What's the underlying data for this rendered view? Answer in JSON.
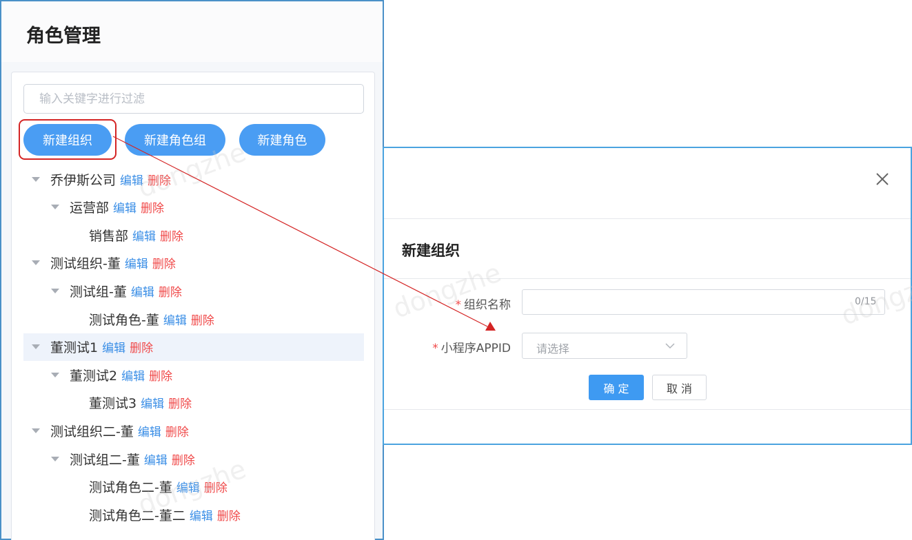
{
  "page": {
    "title": "角色管理"
  },
  "filter": {
    "placeholder": "输入关键字进行过滤"
  },
  "toolbar": {
    "new_org": "新建组织",
    "new_role_group": "新建角色组",
    "new_role": "新建角色"
  },
  "tree": {
    "edit_label": "编辑",
    "delete_label": "删除",
    "nodes": [
      {
        "name": "乔伊斯公司",
        "level": 0,
        "expanded": true,
        "selected": false
      },
      {
        "name": "运营部",
        "level": 1,
        "expanded": true,
        "selected": false
      },
      {
        "name": "销售部",
        "level": 2,
        "expanded": false,
        "selected": false
      },
      {
        "name": "测试组织-董",
        "level": 0,
        "expanded": true,
        "selected": false
      },
      {
        "name": "测试组-董",
        "level": 1,
        "expanded": true,
        "selected": false
      },
      {
        "name": "测试角色-董",
        "level": 2,
        "expanded": false,
        "selected": false
      },
      {
        "name": "董测试1",
        "level": 0,
        "expanded": true,
        "selected": true
      },
      {
        "name": "董测试2",
        "level": 1,
        "expanded": true,
        "selected": false
      },
      {
        "name": "董测试3",
        "level": 2,
        "expanded": false,
        "selected": false
      },
      {
        "name": "测试组织二-董",
        "level": 0,
        "expanded": true,
        "selected": false
      },
      {
        "name": "测试组二-董",
        "level": 1,
        "expanded": true,
        "selected": false
      },
      {
        "name": "测试角色二-董",
        "level": 2,
        "expanded": false,
        "selected": false
      },
      {
        "name": "测试角色二-董二",
        "level": 2,
        "expanded": false,
        "selected": false
      }
    ]
  },
  "watermark": {
    "text": "dongzhe"
  },
  "dialog": {
    "title": "新建组织",
    "close_icon": "close-icon",
    "fields": {
      "org_name": {
        "label": "组织名称",
        "required_mark": "*",
        "value": "",
        "counter": "0/15"
      },
      "appid": {
        "label": "小程序APPID",
        "required_mark": "*",
        "placeholder": "请选择"
      }
    },
    "confirm_label": "确 定",
    "cancel_label": "取 消"
  },
  "colors": {
    "primary": "#4a9df3",
    "danger": "#f04a4a",
    "link": "#3a8ee6",
    "annotation_red": "#d42424",
    "frame_blue": "#4aa3df"
  }
}
